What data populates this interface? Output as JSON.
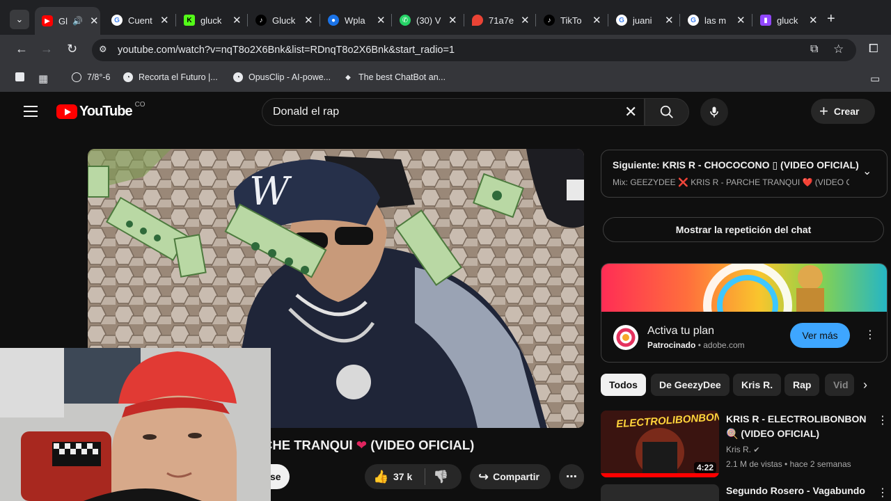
{
  "browser": {
    "tabs": [
      {
        "title": "Gl",
        "color": "#ff0000",
        "icon": "youtube-icon"
      },
      {
        "title": "Cuent",
        "color": "#4285f4",
        "icon": "google-icon"
      },
      {
        "title": "gluck",
        "color": "#53fc18",
        "icon": "kick-icon"
      },
      {
        "title": "Gluck",
        "color": "#000000",
        "icon": "tiktok-icon"
      },
      {
        "title": "Wpla",
        "color": "#1a73e8",
        "icon": "globe-icon"
      },
      {
        "title": "(30) V",
        "color": "#25d366",
        "icon": "whatsapp-icon"
      },
      {
        "title": "71a7e",
        "color": "#ea4335",
        "icon": "maps-pin-icon"
      },
      {
        "title": "TikTo",
        "color": "#000000",
        "icon": "tiktok-icon"
      },
      {
        "title": "juani",
        "color": "#4285f4",
        "icon": "google-icon"
      },
      {
        "title": "las m",
        "color": "#4285f4",
        "icon": "google-icon"
      },
      {
        "title": "gluck",
        "color": "#9146ff",
        "icon": "twitch-icon"
      }
    ],
    "url": "youtube.com/watch?v=nqT8o2X6Bnk&list=RDnqT8o2X6Bnk&start_radio=1",
    "bookmarks": [
      "7/8°-6",
      "Recorta el Futuro |...",
      "OpusClip - AI-powe...",
      "The best ChatBot an..."
    ]
  },
  "youtube": {
    "country": "CO",
    "search_query": "Donald el rap",
    "create_label": "Crear",
    "video_title_visible": "CHE TRANQUI",
    "video_title_suffix": "(VIDEO OFICIAL)",
    "subscribe_partial": "se",
    "likes": "37 k",
    "share_label": "Compartir",
    "next_up": {
      "label": "Siguiente: KRIS R - CHOCOCONO ▯ (VIDEO OFICIAL)",
      "mix": "Mix: GEEZYDEE ❌ KRIS R - PARCHE TRANQUI ❤️ (VIDEO O..."
    },
    "chat_replay": "Mostrar la repetición del chat",
    "ad": {
      "title": "Activa tu plan",
      "sponsored": "Patrocinado",
      "domain": "adobe.com",
      "cta": "Ver más"
    },
    "chips": [
      "Todos",
      "De GeezyDee",
      "Kris R.",
      "Rap",
      "Vid"
    ],
    "related": [
      {
        "title": "KRIS R - ELECTROLIBONBON 🍭 (VIDEO OFICIAL)",
        "channel": "Kris R.",
        "meta": "2.1 M de vistas • hace 2 semanas",
        "duration": "4:22",
        "thumb_text": "ELECTROLIBONBON"
      },
      {
        "title": "Segundo Rosero - Vagabundo"
      }
    ]
  }
}
